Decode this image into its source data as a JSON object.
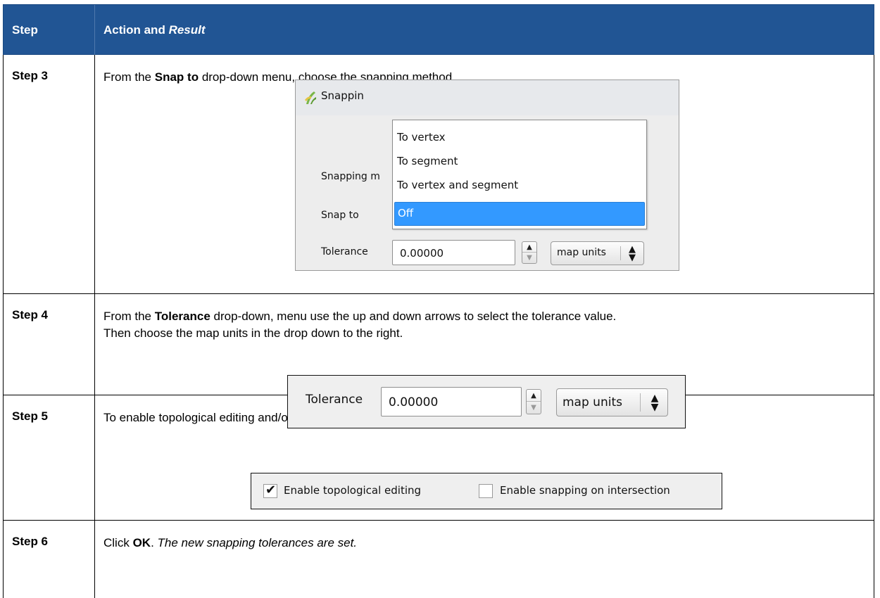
{
  "header": {
    "col1": "Step",
    "col2_prefix": "Action and ",
    "col2_italic": "Result"
  },
  "rows": [
    {
      "step": "Step 3",
      "text_before": "From the ",
      "text_bold": "Snap to",
      "text_after": " drop-down menu, choose the snapping method.",
      "dialog": {
        "title": "Snappin",
        "snapping_mode_label": "Snapping m",
        "snap_to_label": "Snap to",
        "tolerance_label": "Tolerance",
        "tolerance_value": "0.00000",
        "units_value": "map units",
        "options": [
          "To vertex",
          "To segment",
          "To vertex and segment",
          "Off"
        ],
        "selected_option": "Off",
        "selection_color": "#3399ff"
      }
    },
    {
      "step": "Step 4",
      "text_before": "From the ",
      "text_bold": "Tolerance",
      "text_after": " drop-down, menu use the up and down arrows to select the tolerance value.",
      "text_line2": "Then choose the map units in the drop down to the right.",
      "tolerance": {
        "label": "Tolerance",
        "value": "0.00000",
        "units": "map units"
      }
    },
    {
      "step": "Step 5",
      "text": "To enable topological editing and/or snapping on an intersection use the checkboxes next to each.",
      "checkboxes": [
        {
          "label": "Enable topological editing",
          "checked": true
        },
        {
          "label": "Enable snapping on intersection",
          "checked": false
        }
      ]
    },
    {
      "step": "Step 6",
      "text_before": "Click ",
      "text_bold": "OK",
      "text_after": ". ",
      "text_italic": "The new snapping tolerances are set."
    }
  ],
  "colors": {
    "header_bg": "#215594",
    "header_text": "#ffffff",
    "border": "#000000"
  }
}
